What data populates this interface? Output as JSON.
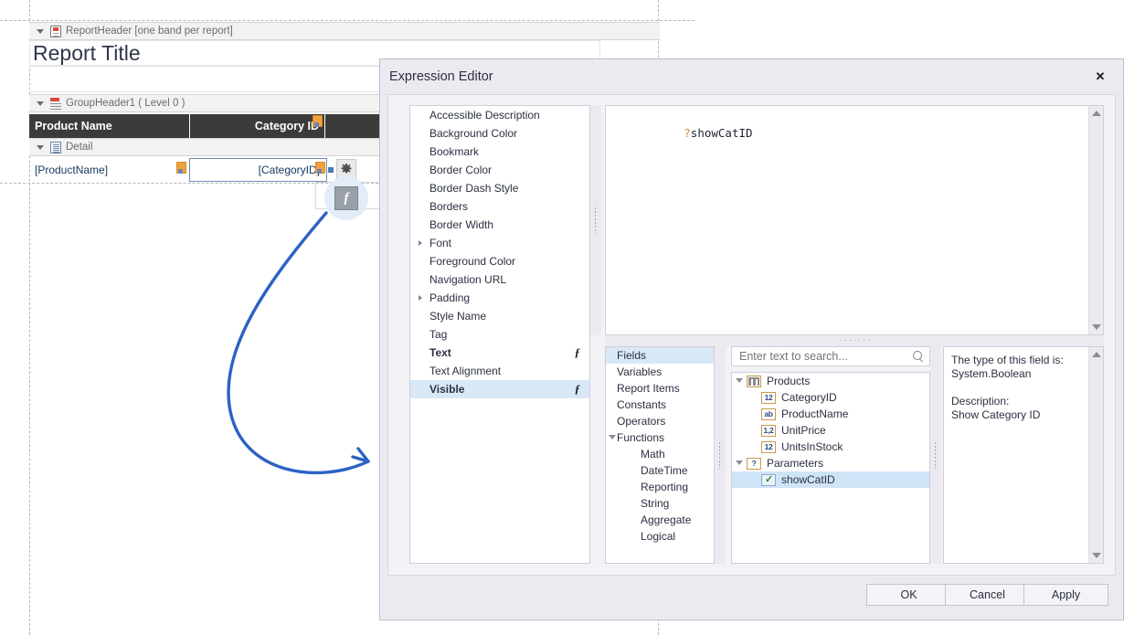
{
  "designer": {
    "bands": [
      {
        "name": "report-header",
        "label": "ReportHeader [one band per report]",
        "icon": "report-header-icon"
      },
      {
        "name": "group-header",
        "label": "GroupHeader1 ( Level 0 )",
        "icon": "group-header-icon"
      },
      {
        "name": "detail",
        "label": "Detail",
        "icon": "detail-band-icon"
      }
    ],
    "report_title": "Report Title",
    "table_headers": [
      "Product Name",
      "Category ID",
      ""
    ],
    "detail_cells": [
      "[ProductName]",
      "[CategoryID]"
    ],
    "fx_button_label": "f",
    "gear_icon": "gear-icon"
  },
  "dialog": {
    "title": "Expression Editor",
    "close_label": "✕",
    "properties": [
      {
        "label": "Accessible Description",
        "bold": false,
        "fx": false,
        "expandable": false,
        "selected": false
      },
      {
        "label": "Background Color",
        "bold": false,
        "fx": false,
        "expandable": false,
        "selected": false
      },
      {
        "label": "Bookmark",
        "bold": false,
        "fx": false,
        "expandable": false,
        "selected": false
      },
      {
        "label": "Border Color",
        "bold": false,
        "fx": false,
        "expandable": false,
        "selected": false
      },
      {
        "label": "Border Dash Style",
        "bold": false,
        "fx": false,
        "expandable": false,
        "selected": false
      },
      {
        "label": "Borders",
        "bold": false,
        "fx": false,
        "expandable": false,
        "selected": false
      },
      {
        "label": "Border Width",
        "bold": false,
        "fx": false,
        "expandable": false,
        "selected": false
      },
      {
        "label": "Font",
        "bold": false,
        "fx": false,
        "expandable": true,
        "selected": false
      },
      {
        "label": "Foreground Color",
        "bold": false,
        "fx": false,
        "expandable": false,
        "selected": false
      },
      {
        "label": "Navigation URL",
        "bold": false,
        "fx": false,
        "expandable": false,
        "selected": false
      },
      {
        "label": "Padding",
        "bold": false,
        "fx": false,
        "expandable": true,
        "selected": false
      },
      {
        "label": "Style Name",
        "bold": false,
        "fx": false,
        "expandable": false,
        "selected": false
      },
      {
        "label": "Tag",
        "bold": false,
        "fx": false,
        "expandable": false,
        "selected": false
      },
      {
        "label": "Text",
        "bold": true,
        "fx": true,
        "expandable": false,
        "selected": false
      },
      {
        "label": "Text Alignment",
        "bold": false,
        "fx": false,
        "expandable": false,
        "selected": false
      },
      {
        "label": "Visible",
        "bold": true,
        "fx": true,
        "expandable": false,
        "selected": true
      }
    ],
    "fx_glyph": "ƒ",
    "expression": {
      "prefix": "?",
      "name": "showCatID"
    },
    "categories": [
      {
        "label": "Fields",
        "selected": true,
        "child": false,
        "expandable": false
      },
      {
        "label": "Variables",
        "selected": false,
        "child": false,
        "expandable": false
      },
      {
        "label": "Report Items",
        "selected": false,
        "child": false,
        "expandable": false
      },
      {
        "label": "Constants",
        "selected": false,
        "child": false,
        "expandable": false
      },
      {
        "label": "Operators",
        "selected": false,
        "child": false,
        "expandable": false
      },
      {
        "label": "Functions",
        "selected": false,
        "child": false,
        "expandable": true
      },
      {
        "label": "Math",
        "selected": false,
        "child": true,
        "expandable": false
      },
      {
        "label": "DateTime",
        "selected": false,
        "child": true,
        "expandable": false
      },
      {
        "label": "Reporting",
        "selected": false,
        "child": true,
        "expandable": false
      },
      {
        "label": "String",
        "selected": false,
        "child": true,
        "expandable": false
      },
      {
        "label": "Aggregate",
        "selected": false,
        "child": true,
        "expandable": false
      },
      {
        "label": "Logical",
        "selected": false,
        "child": true,
        "expandable": false
      }
    ],
    "search": {
      "value": "",
      "placeholder": "Enter text to search...",
      "icon": "search-icon"
    },
    "fields": [
      {
        "label": "Products",
        "icon": "table-icon",
        "icon_text": "",
        "level": 0,
        "expandable": true,
        "selected": false
      },
      {
        "label": "CategoryID",
        "icon": "integer-icon",
        "icon_text": "12",
        "level": 1,
        "expandable": false,
        "selected": false
      },
      {
        "label": "ProductName",
        "icon": "string-icon",
        "icon_text": "ab",
        "level": 1,
        "expandable": false,
        "selected": false
      },
      {
        "label": "UnitPrice",
        "icon": "decimal-icon",
        "icon_text": "1,2",
        "level": 1,
        "expandable": false,
        "selected": false
      },
      {
        "label": "UnitsInStock",
        "icon": "integer-icon",
        "icon_text": "12",
        "level": 1,
        "expandable": false,
        "selected": false
      },
      {
        "label": "Parameters",
        "icon": "parameter-icon",
        "icon_text": "?",
        "level": 0,
        "expandable": true,
        "selected": false
      },
      {
        "label": "showCatID",
        "icon": "boolean-icon",
        "icon_text": "",
        "level": 1,
        "expandable": false,
        "selected": true
      }
    ],
    "description": "The type of this field is:\nSystem.Boolean\n\nDescription:\nShow Category ID",
    "buttons": [
      {
        "label": "OK",
        "name": "ok-button"
      },
      {
        "label": "Cancel",
        "name": "cancel-button"
      },
      {
        "label": "Apply",
        "name": "apply-button"
      }
    ]
  },
  "annotation": {
    "arrow_color": "#2b62c4",
    "highlight_color": "#e3ecf9"
  }
}
